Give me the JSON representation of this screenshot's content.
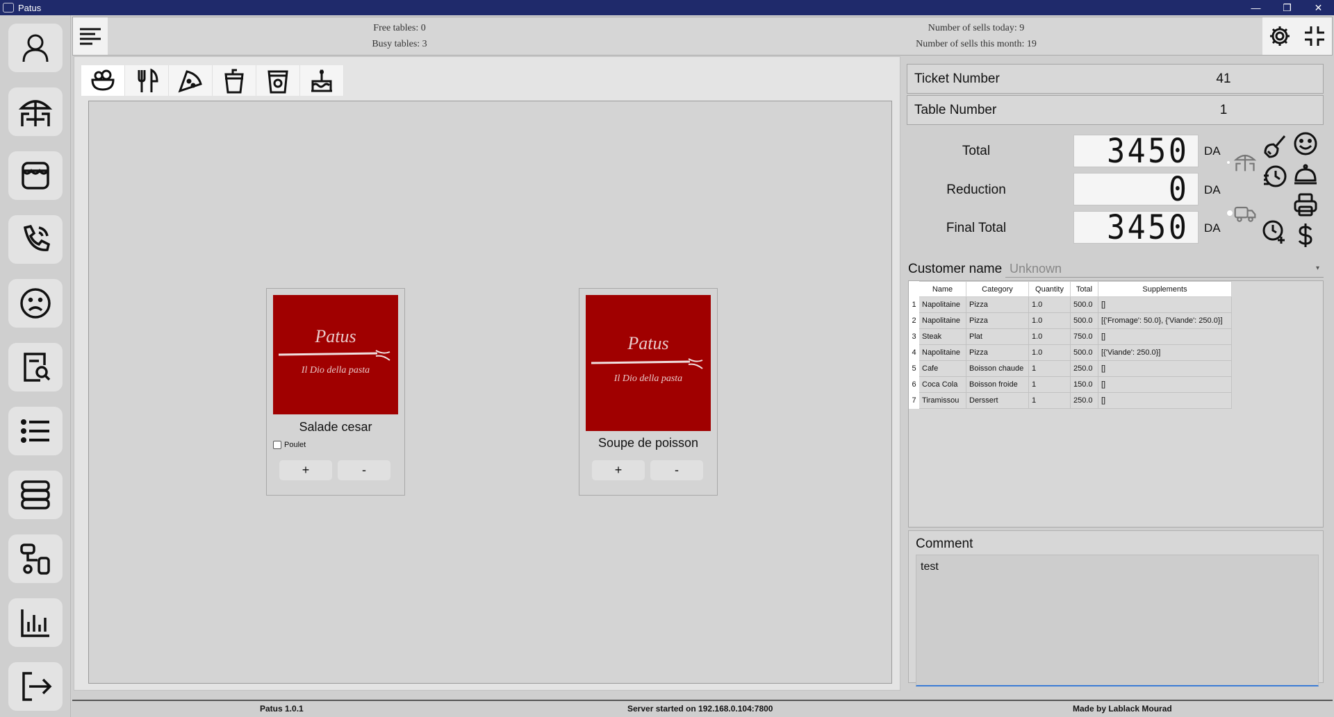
{
  "window": {
    "title": "Patus",
    "minimize": "—",
    "maximize": "❐",
    "close": "✕"
  },
  "header": {
    "free_tables": "Free tables: 0",
    "busy_tables": "Busy tables: 3",
    "sells_today": "Number of sells today: 9",
    "sells_month": "Number of sells this month: 19"
  },
  "sidebar": {
    "items": [
      {
        "icon": "user-icon"
      },
      {
        "icon": "terrace-icon"
      },
      {
        "icon": "store-icon"
      },
      {
        "icon": "phone-icon"
      },
      {
        "icon": "sad-face-icon"
      },
      {
        "icon": "search-document-icon"
      },
      {
        "icon": "list-icon"
      },
      {
        "icon": "server-icon"
      },
      {
        "icon": "workflow-icon"
      },
      {
        "icon": "chart-icon"
      },
      {
        "icon": "logout-icon"
      }
    ]
  },
  "category_tabs": [
    "salad-bowl-icon",
    "cutlery-icon",
    "pizza-icon",
    "drink-icon",
    "soft-drink-icon",
    "cake-icon"
  ],
  "products": [
    {
      "name": "Salade cesar",
      "option_label": "Poulet",
      "plus_label": "+",
      "minus_label": "-",
      "logo_text_1": "Patus",
      "logo_text_2": "Il Dio della pasta"
    },
    {
      "name": "Soupe de poisson",
      "plus_label": "+",
      "minus_label": "-",
      "logo_text_1": "Patus",
      "logo_text_2": "Il Dio della pasta"
    }
  ],
  "ticket": {
    "ticket_number_label": "Ticket Number",
    "ticket_number": "41",
    "table_number_label": "Table Number",
    "table_number": "1",
    "total_label": "Total",
    "total": "3450",
    "reduction_label": "Reduction",
    "reduction": "0",
    "final_total_label": "Final Total",
    "final_total": "3450",
    "currency": "DA"
  },
  "customer": {
    "label": "Customer name",
    "value": "Unknown"
  },
  "order_table": {
    "columns": [
      "Name",
      "Category",
      "Quantity",
      "Total",
      "Supplements"
    ],
    "rows": [
      [
        "1",
        "Napolitaine",
        "Pizza",
        "1.0",
        "500.0",
        "[]"
      ],
      [
        "2",
        "Napolitaine",
        "Pizza",
        "1.0",
        "500.0",
        "[{'Fromage': 50.0}, {'Viande': 250.0}]"
      ],
      [
        "3",
        "Steak",
        "Plat",
        "1.0",
        "750.0",
        "[]"
      ],
      [
        "4",
        "Napolitaine",
        "Pizza",
        "1.0",
        "500.0",
        "[{'Viande': 250.0}]"
      ],
      [
        "5",
        "Cafe",
        "Boisson chaude",
        "1",
        "250.0",
        "[]"
      ],
      [
        "6",
        "Coca Cola",
        "Boisson froide",
        "1",
        "150.0",
        "[]"
      ],
      [
        "7",
        "Tiramissou",
        "Derssert",
        "1",
        "250.0",
        "[]"
      ]
    ]
  },
  "comment": {
    "label": "Comment",
    "value": "test"
  },
  "statusbar": {
    "version": "Patus 1.0.1",
    "server": "Server started on 192.168.0.104:7800",
    "author": "Made by Lablack Mourad"
  }
}
